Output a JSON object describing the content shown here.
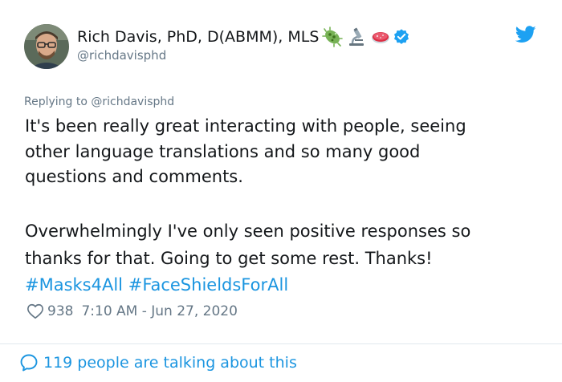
{
  "author": {
    "display_name": "Rich Davis, PhD, D(ABMM), MLS",
    "handle": "@richdavisphd",
    "name_emojis": [
      "microbe-icon",
      "microscope-icon",
      "petri-dish-icon"
    ],
    "verified_icon": "verified-badge-icon",
    "avatar": "avatar"
  },
  "replying_to": "Replying to @richdavisphd",
  "body": {
    "lines": [
      "It's been really great interacting with people, seeing",
      "other language translations and so many good",
      "questions and comments.",
      "Overwhelmingly I've only seen positive responses so",
      "thanks for that. Going to get some rest. Thanks!"
    ],
    "hashtags": [
      "#Masks4All",
      "#FaceShieldsForAll"
    ]
  },
  "meta": {
    "likes": "938",
    "timestamp": "7:10 AM - Jun 27, 2020"
  },
  "footer": {
    "talking": "119 people are talking about this"
  },
  "colors": {
    "link": "#1b95e0",
    "secondary": "#657786",
    "text": "#14171a",
    "divider": "#e1e8ed",
    "twitter_blue": "#1da1f2"
  }
}
